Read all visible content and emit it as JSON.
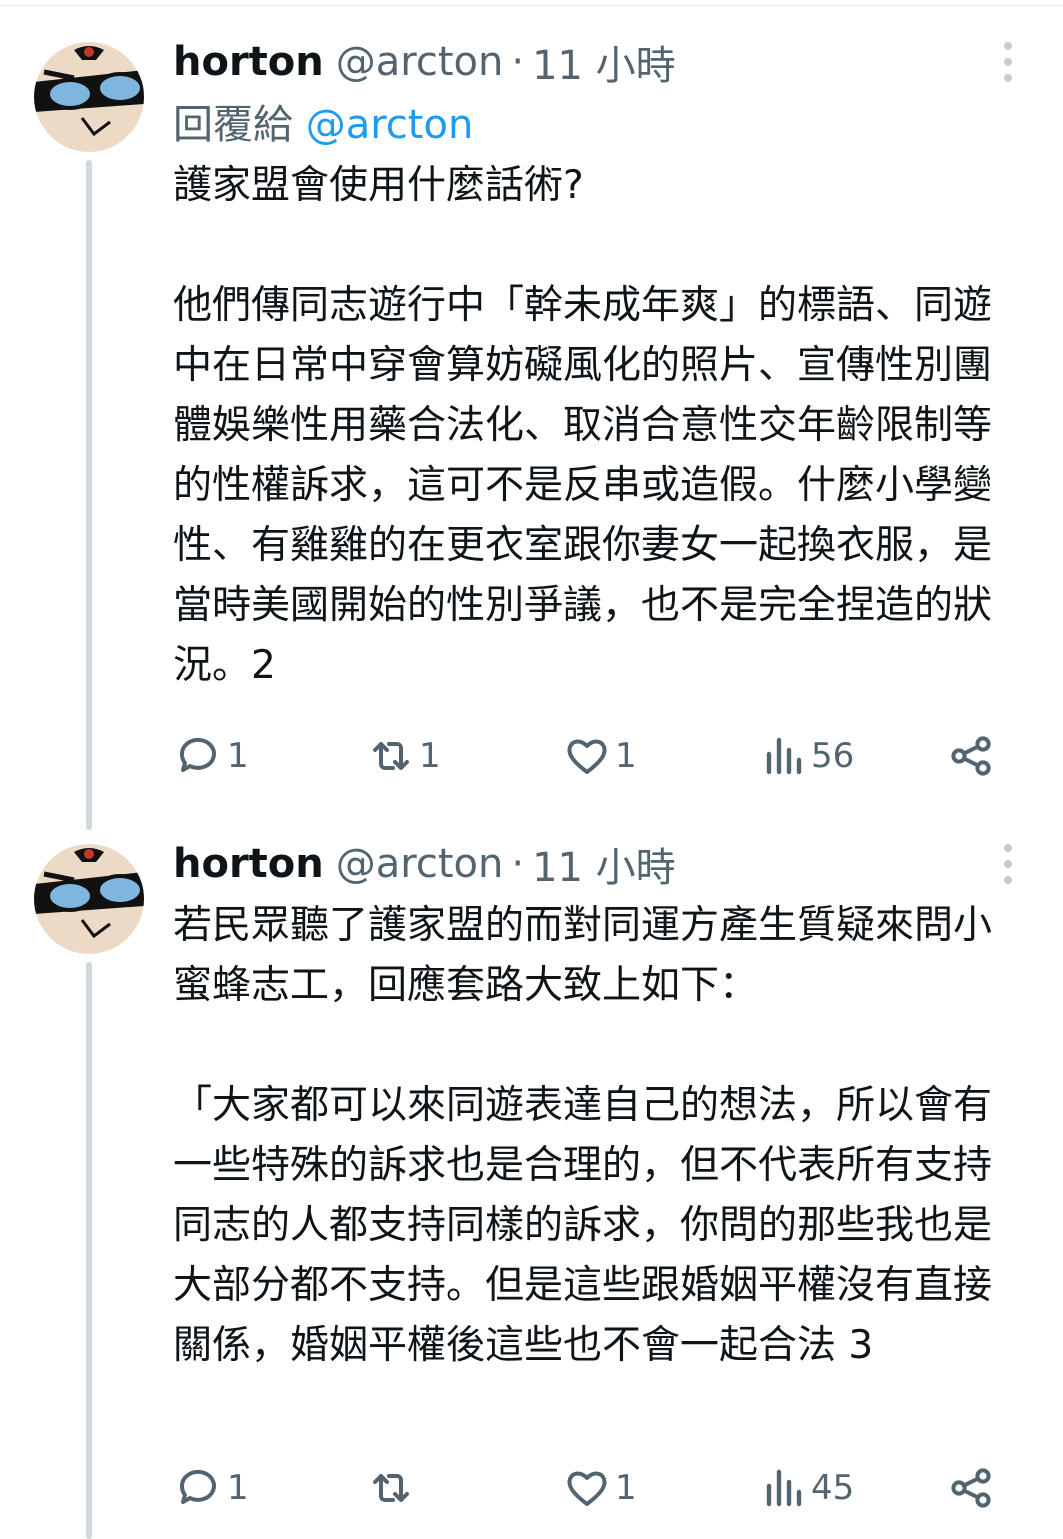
{
  "tweets": [
    {
      "name": "horton",
      "handle": "@arcton",
      "dot": "·",
      "time": "11 小時",
      "reply_prefix": "回覆給",
      "reply_to": "@arcton",
      "paragraphs": [
        "護家盟會使用什麼話術?",
        "他們傳同志遊行中「幹未成年爽」的標語、同遊中在日常中穿會算妨礙風化的照片、宣傳性別團體娛樂性用藥合法化、取消合意性交年齡限制等的性權訴求，這可不是反串或造假。什麼小學變性、有雞雞的在更衣室跟你妻女一起換衣服，是當時美國開始的性別爭議，也不是完全捏造的狀況。2"
      ],
      "replies": "1",
      "retweets": "1",
      "likes": "1",
      "views": "56"
    },
    {
      "name": "horton",
      "handle": "@arcton",
      "dot": "·",
      "time": "11 小時",
      "paragraphs": [
        "若民眾聽了護家盟的而對同運方產生質疑來問小蜜蜂志工，回應套路大致上如下：",
        "「大家都可以來同遊表達自己的想法，所以會有一些特殊的訴求也是合理的，但不代表所有支持同志的人都支持同樣的訴求，你問的那些我也是大部分都不支持。但是這些跟婚姻平權沒有直接關係，婚姻平權後這些也不會一起合法 3"
      ],
      "replies": "1",
      "retweets": "",
      "likes": "1",
      "views": "45"
    }
  ],
  "icons": {
    "reply": "reply-icon",
    "retweet": "retweet-icon",
    "like": "heart-icon",
    "views": "views-icon",
    "share": "share-icon",
    "more": "more-vertical-icon"
  },
  "colors": {
    "text": "#0f1419",
    "secondary": "#536471",
    "link": "#1d9bf0",
    "thread_line": "#cfd9de",
    "avatar_bg": "#ecd9c6"
  }
}
